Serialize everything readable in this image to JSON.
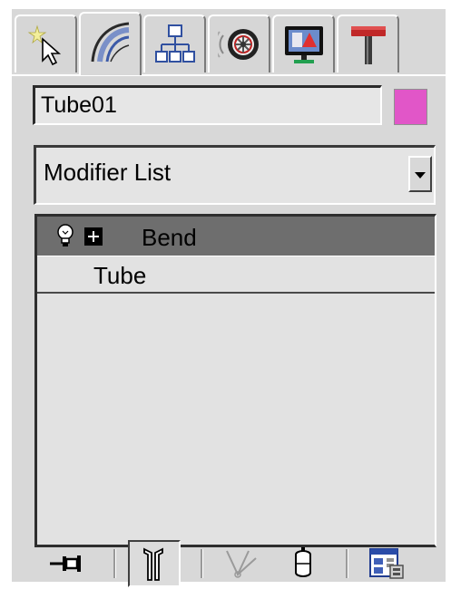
{
  "command_panel": {
    "tabs": [
      {
        "name": "Create",
        "icon": "create-cursor-star-icon",
        "active": false
      },
      {
        "name": "Modify",
        "icon": "modify-arc-icon",
        "active": true
      },
      {
        "name": "Hierarchy",
        "icon": "hierarchy-tree-icon",
        "active": false
      },
      {
        "name": "Motion",
        "icon": "motion-wheel-icon",
        "active": false
      },
      {
        "name": "Display",
        "icon": "display-monitor-icon",
        "active": false
      },
      {
        "name": "Utilities",
        "icon": "utilities-hammer-icon",
        "active": false
      }
    ],
    "object_name": "Tube01",
    "object_color": "#e156c8",
    "modifier_list_label": "Modifier List",
    "stack": [
      {
        "label": "Bend",
        "selected": true,
        "has_bulb": true,
        "expandable": true
      },
      {
        "label": "Tube",
        "selected": false,
        "has_bulb": false,
        "expandable": false
      }
    ],
    "toolbar_icons": [
      "pin-stack-icon",
      "show-end-result-icon",
      "make-unique-icon",
      "remove-modifier-icon",
      "configure-modifier-sets-icon"
    ]
  }
}
